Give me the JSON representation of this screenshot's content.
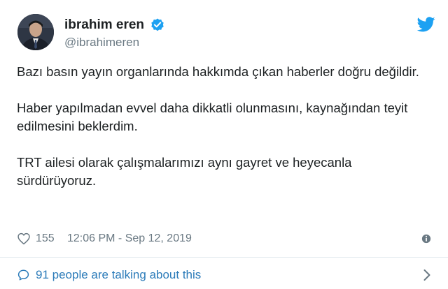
{
  "user": {
    "display_name": "ibrahim eren",
    "handle": "@ibrahimeren",
    "verified": true,
    "avatar_icon": "user-portrait-avatar"
  },
  "brand": {
    "icon": "twitter-bird-icon",
    "color": "#1da1f2"
  },
  "tweet": {
    "paragraphs": [
      "Bazı basın yayın organlarında hakkımda çıkan haberler doğru değildir.",
      "Haber yapılmadan evvel daha dikkatli olunmasını, kaynağından teyit edilmesini beklerdim.",
      "TRT ailesi olarak çalışmalarımızı aynı gayret ve heyecanla sürdürüyoruz."
    ]
  },
  "meta": {
    "like_icon": "heart-icon",
    "like_count": "155",
    "timestamp": "12:06 PM - Sep 12, 2019",
    "info_icon": "info-icon"
  },
  "conversation": {
    "icon": "speech-bubble-icon",
    "label": "91 people are talking about this",
    "chevron_icon": "chevron-right-icon",
    "color": "#2b7bb9"
  },
  "colors": {
    "text_primary": "#1c2022",
    "text_secondary": "#697882",
    "divider": "#e1e8ed"
  }
}
